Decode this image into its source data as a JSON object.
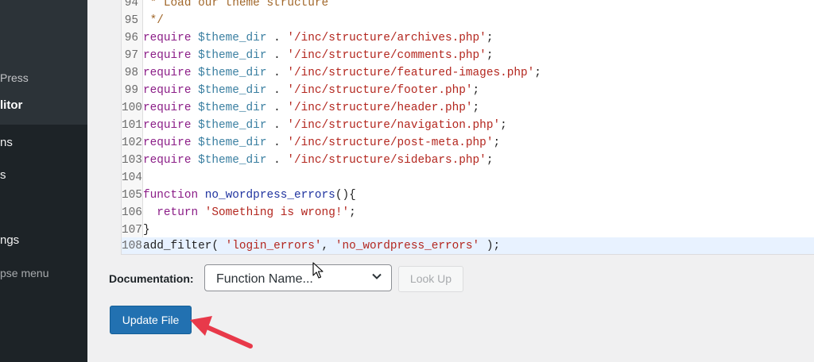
{
  "sidebar": {
    "items": [
      {
        "label": "Press",
        "type": "sub"
      },
      {
        "label": "litor",
        "type": "current"
      },
      {
        "label": "ns",
        "type": "top"
      },
      {
        "label": "s",
        "type": "top"
      },
      {
        "label": "ngs",
        "type": "top"
      },
      {
        "label": "pse menu",
        "type": "collapse"
      }
    ]
  },
  "editor": {
    "lines": [
      {
        "num": "94",
        "text": " * Load our theme structure"
      },
      {
        "num": "95",
        "text": " */"
      },
      {
        "num": "96",
        "kw": "require",
        "var": "$theme_dir",
        "op": ".",
        "str": "'/inc/structure/archives.php'",
        "end": ";"
      },
      {
        "num": "97",
        "kw": "require",
        "var": "$theme_dir",
        "op": ".",
        "str": "'/inc/structure/comments.php'",
        "end": ";"
      },
      {
        "num": "98",
        "kw": "require",
        "var": "$theme_dir",
        "op": ".",
        "str": "'/inc/structure/featured-images.php'",
        "end": ";"
      },
      {
        "num": "99",
        "kw": "require",
        "var": "$theme_dir",
        "op": ".",
        "str": "'/inc/structure/footer.php'",
        "end": ";"
      },
      {
        "num": "100",
        "kw": "require",
        "var": "$theme_dir",
        "op": ".",
        "str": "'/inc/structure/header.php'",
        "end": ";"
      },
      {
        "num": "101",
        "kw": "require",
        "var": "$theme_dir",
        "op": ".",
        "str": "'/inc/structure/navigation.php'",
        "end": ";"
      },
      {
        "num": "102",
        "kw": "require",
        "var": "$theme_dir",
        "op": ".",
        "str": "'/inc/structure/post-meta.php'",
        "end": ";"
      },
      {
        "num": "103",
        "kw": "require",
        "var": "$theme_dir",
        "op": ".",
        "str": "'/inc/structure/sidebars.php'",
        "end": ";"
      },
      {
        "num": "104"
      },
      {
        "num": "105",
        "kw": "function",
        "def": "no_wordpress_errors",
        "end": "(){"
      },
      {
        "num": "106",
        "indent": "  ",
        "kw": "return",
        "str": "'Something is wrong!'",
        "end": ";"
      },
      {
        "num": "107",
        "plain": "}"
      },
      {
        "num": "108",
        "active": true,
        "plain": "add_filter(",
        "str": "'login_errors'",
        "mid": ",",
        "str2": "'no_wordpress_errors'",
        "end": " );"
      }
    ]
  },
  "documentation": {
    "label": "Documentation:",
    "select_value": "Function Name...",
    "lookup_label": "Look Up"
  },
  "update_button": {
    "label": "Update File"
  },
  "colors": {
    "primary": "#2271b1",
    "arrow": "#e8394a",
    "sidebar": "#1d2327"
  }
}
